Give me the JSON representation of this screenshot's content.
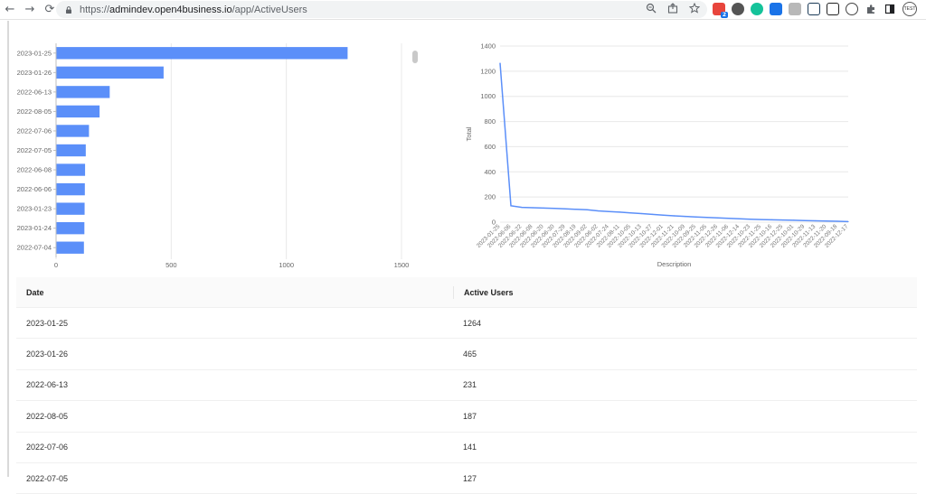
{
  "browser": {
    "url_prefix": "https://",
    "url_host": "admindev.open4business.io",
    "url_path": "/app/ActiveUsers",
    "back": "←",
    "forward": "→",
    "reload": "⟳",
    "zoom_icon": "zoom-icon",
    "share_icon": "share-icon",
    "star_icon": "star-icon",
    "extension_badge": "2",
    "profile_text": "TEST"
  },
  "chart_data": [
    {
      "type": "bar",
      "orientation": "horizontal",
      "categories": [
        "2023-01-25",
        "2023-01-26",
        "2022-06-13",
        "2022-08-05",
        "2022-07-06",
        "2022-07-05",
        "2022-06-08",
        "2022-06-06",
        "2023-01-23",
        "2023-01-24",
        "2022-07-04"
      ],
      "values": [
        1264,
        465,
        231,
        187,
        141,
        127,
        124,
        123,
        122,
        121,
        119
      ],
      "xlim": [
        0,
        1500
      ],
      "xticks": [
        "0",
        "500",
        "1000",
        "1500"
      ],
      "grid": true,
      "color": "#5b8ff9"
    },
    {
      "type": "line",
      "ylabel": "Total",
      "xlabel": "Description",
      "ylim": [
        0,
        1400
      ],
      "yticks": [
        "0",
        "200",
        "400",
        "600",
        "800",
        "1000",
        "1200",
        "1400"
      ],
      "x": [
        "2023-01-25",
        "2022-06-06",
        "2022-06-22",
        "2022-06-08",
        "2022-06-20",
        "2022-06-30",
        "2022-07-29",
        "2022-08-19",
        "2022-09-02",
        "2022-06-02",
        "2022-07-24",
        "2022-08-11",
        "2022-10-05",
        "2022-10-13",
        "2022-10-27",
        "2022-12-01",
        "2022-11-21",
        "2022-10-09",
        "2022-09-25",
        "2022-11-05",
        "2022-12-26",
        "2022-11-06",
        "2022-12-14",
        "2022-10-23",
        "2022-11-25",
        "2022-10-16",
        "2022-12-25",
        "2022-10-01",
        "2022-10-29",
        "2022-11-13",
        "2022-11-20",
        "2022-09-18",
        "2022-12-17"
      ],
      "values": [
        1264,
        130,
        118,
        115,
        112,
        110,
        106,
        102,
        98,
        90,
        85,
        80,
        74,
        68,
        62,
        56,
        50,
        46,
        42,
        38,
        34,
        30,
        27,
        24,
        21,
        19,
        17,
        15,
        13,
        11,
        9,
        7,
        4
      ],
      "grid": true,
      "color": "#5b8ff9"
    }
  ],
  "table": {
    "headers": [
      "Date",
      "Active Users"
    ],
    "rows": [
      [
        "2023-01-25",
        "1264"
      ],
      [
        "2023-01-26",
        "465"
      ],
      [
        "2022-06-13",
        "231"
      ],
      [
        "2022-08-05",
        "187"
      ],
      [
        "2022-07-06",
        "141"
      ],
      [
        "2022-07-05",
        "127"
      ]
    ]
  }
}
